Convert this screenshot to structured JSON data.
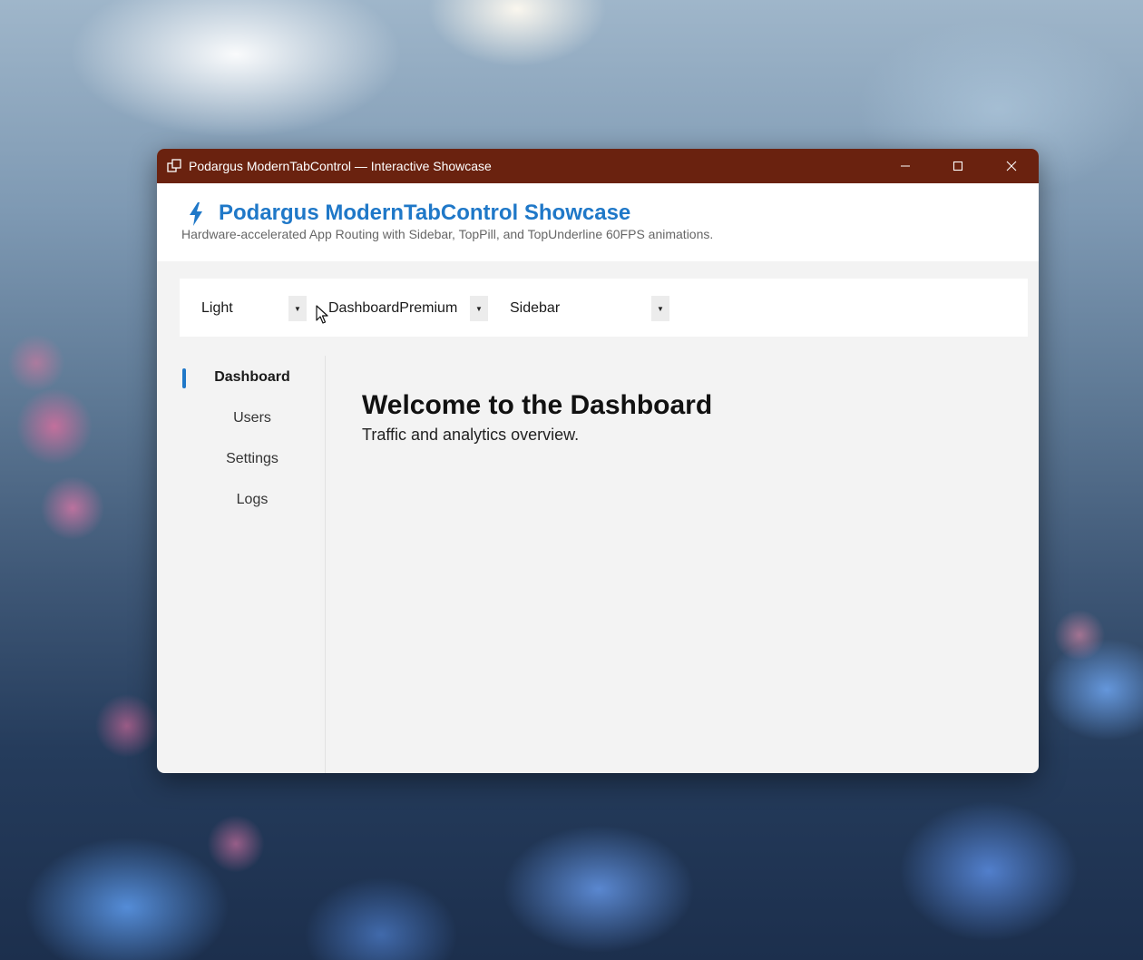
{
  "window": {
    "title": "Podargus ModernTabControl — Interactive Showcase",
    "titlebar_color": "#6a220f"
  },
  "header": {
    "title": "Podargus ModernTabControl Showcase",
    "subtitle": "Hardware-accelerated App Routing with Sidebar, TopPill, and TopUnderline 60FPS animations.",
    "accent_color": "#1f78c8"
  },
  "toolbar": {
    "theme_select": "Light",
    "preset_select": "DashboardPremium",
    "style_select": "Sidebar"
  },
  "sidebar": {
    "items": [
      {
        "label": "Dashboard",
        "active": true
      },
      {
        "label": "Users",
        "active": false
      },
      {
        "label": "Settings",
        "active": false
      },
      {
        "label": "Logs",
        "active": false
      }
    ]
  },
  "main": {
    "heading": "Welcome to the Dashboard",
    "subheading": "Traffic and analytics overview."
  },
  "icons": [
    "app-icon",
    "minimize-icon",
    "maximize-icon",
    "close-icon",
    "bolt-icon",
    "chevron-down-icon",
    "mouse-cursor-icon"
  ]
}
